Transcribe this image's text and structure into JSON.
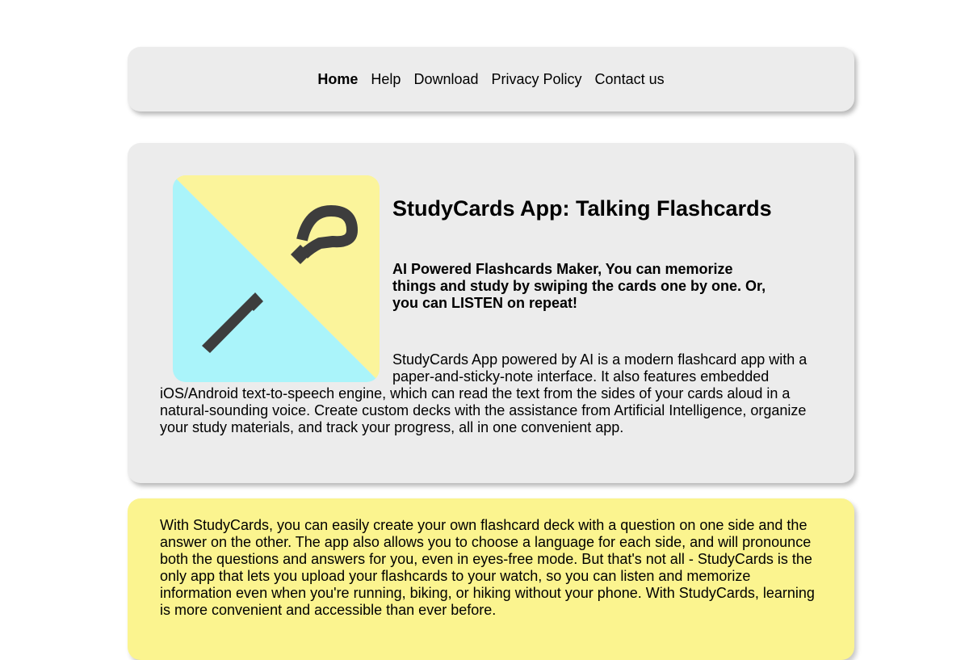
{
  "nav": {
    "items": [
      {
        "label": "Home",
        "active": true
      },
      {
        "label": "Help",
        "active": false
      },
      {
        "label": "Download",
        "active": false
      },
      {
        "label": "Privacy Policy",
        "active": false
      },
      {
        "label": "Contact us",
        "active": false
      }
    ]
  },
  "hero": {
    "logo_icon": "question-and-exclamation-mark-icon",
    "title": "StudyCards App: Talking Flashcards",
    "tagline": "AI Powered Flashcards Maker, You can memorize things and study by swiping the cards one by one. Or, you can LISTEN on repeat!",
    "description": "StudyCards App powered by AI is a modern flashcard app with a paper-and-sticky-note interface. It also features embedded iOS/Android text-to-speech engine, which can read the text from the sides of your cards aloud in a natural-sounding voice. Create custom decks with the assistance from Artificial Intelligence, organize your study materials, and track your progress, all in one convenient app."
  },
  "feature": {
    "text": "With StudyCards, you can easily create your own flashcard deck with a question on one side and the answer on the other. The app also allows you to choose a language for each side, and will pronounce both the questions and answers for you, even in eyes-free mode. But that's not all - StudyCards is the only app that lets you upload your flashcards to your watch, so you can listen and memorize information even when you're running, biking, or hiking without your phone. With StudyCards, learning is more convenient and accessible than ever before."
  },
  "colors": {
    "card_gray": "#ececec",
    "card_yellow": "#fbf48f",
    "logo_cyan": "#aaf4fa",
    "logo_yellow": "#fbf49b",
    "logo_glyph": "#3d3d3d"
  }
}
